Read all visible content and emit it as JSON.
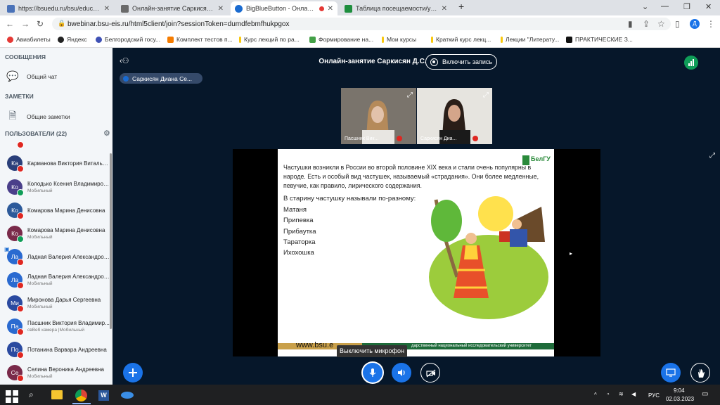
{
  "browser": {
    "tabs": [
      {
        "label": "https://bsuedu.ru/bsu/education",
        "color": "#4a72b8"
      },
      {
        "label": "Онлайн-занятие Саркисян Д.С.",
        "color": "#6a6a6a"
      },
      {
        "label": "BigBlueButton - Онлайн-зан",
        "color": "#1a6bd0",
        "active": true
      },
      {
        "label": "Таблица посещаемости/успева",
        "color": "#1e8e3e"
      }
    ],
    "url": "bwebinar.bsu-eis.ru/html5client/join?sessionToken=dumdfebmfhukpgox",
    "profile_initial": "Д",
    "bookmarks": [
      {
        "label": "Авиабилеты",
        "color": "#e53935"
      },
      {
        "label": "Яндекс",
        "color": "#222222"
      },
      {
        "label": "Белгородский госу...",
        "color": "#3f51b5"
      },
      {
        "label": "Комплект тестов п...",
        "color": "#f57c00"
      },
      {
        "label": "Курс лекций по ра...",
        "color": "#f9c80e"
      },
      {
        "label": "Формирование на...",
        "color": "#43a047"
      },
      {
        "label": "Мои курсы",
        "color": "#f9c80e"
      },
      {
        "label": "Краткий курс лекц...",
        "color": "#f9c80e"
      },
      {
        "label": "Лекции \"Литерату...",
        "color": "#f9c80e"
      },
      {
        "label": "ПРАКТИЧЕСКИЕ З...",
        "color": "#111111"
      }
    ]
  },
  "sidebar": {
    "messages_title": "СООБЩЕНИЯ",
    "public_chat": "Общий чат",
    "notes_title": "ЗАМЕТКИ",
    "shared_notes": "Общие заметки",
    "users_title": "ПОЛЬЗОВАТЕЛИ (22)",
    "users": [
      {
        "initials": "Ка",
        "name": "Карманова Виктория Витальев...",
        "sub": "",
        "color": "#2a3f7a"
      },
      {
        "initials": "Ко",
        "name": "Колодько Ксения Владимировна",
        "sub": "Мобильный",
        "color": "#4a3f8a"
      },
      {
        "initials": "Ко",
        "name": "Комарова Марина Денисовна",
        "sub": "",
        "color": "#2d5a9a"
      },
      {
        "initials": "Ко",
        "name": "Комарова Марина Денисовна",
        "sub": "Мобильный",
        "color": "#7a2a4a"
      },
      {
        "initials": "Ла",
        "name": "Ладная Валерия Александровна",
        "sub": "",
        "color": "#2a6ad0"
      },
      {
        "initials": "Ла",
        "name": "Ладная Валерия Александровна",
        "sub": "Мобильный",
        "color": "#2a6ad0"
      },
      {
        "initials": "Ми",
        "name": "Миронова Дарья Сергеевна",
        "sub": "Мобильный",
        "color": "#2a4aa0"
      },
      {
        "initials": "Па",
        "name": "Пасшник Виктория Владимир...",
        "sub": "свВеб камера |Мобильный",
        "color": "#2a6ad0"
      },
      {
        "initials": "По",
        "name": "Потанина Варвара Андреевна",
        "sub": "",
        "color": "#2a4aa0"
      },
      {
        "initials": "Се",
        "name": "Селина Вероника Андреевна",
        "sub": "Мобильный",
        "color": "#7a2a4a"
      }
    ]
  },
  "meeting": {
    "title": "Онлайн-занятие Саркисян Д.С.",
    "record_label": "Включить запись",
    "talking": "Саркисян Диана Се...",
    "videos": [
      {
        "name": "Пасшник Вик...",
        "bg": "#3a3a3a"
      },
      {
        "name": "Саркисян Диа...",
        "bg": "#4a4a4a"
      }
    ],
    "mic_tooltip": "Выключить микрофон"
  },
  "slide": {
    "paragraph": "Частушки возникли в России во второй половине XIX века и стали очень популярны в народе.  Есть и особый вид частушек, называемый «страдания». Они более медленные, певучие, как правило, лирического содержания.",
    "lines": [
      "В старину частушку называли по-разному:",
      "Матаня",
      "Припевка",
      "Прибаутка",
      "Тараторка",
      "Ихохошка"
    ],
    "url": "www.bsu.e",
    "footer": "дарственный национальный исследовательский университет",
    "brand": "БелГУ"
  },
  "taskbar": {
    "lang": "РУС",
    "time": "9:04",
    "date": "02.03.2023"
  }
}
